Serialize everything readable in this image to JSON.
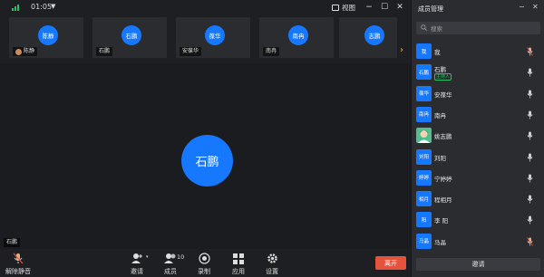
{
  "top_bar": {
    "time": "01:05",
    "view_label": "视图"
  },
  "thumbnails": [
    {
      "avatar": "陈静",
      "name": "陈静"
    },
    {
      "avatar": "石鹏",
      "name": "石鹏"
    },
    {
      "avatar": "葆华",
      "name": "安葆华"
    },
    {
      "avatar": "南冉",
      "name": "南冉"
    },
    {
      "avatar": "志鹏",
      "name": ""
    }
  ],
  "stage": {
    "avatar_text": "石鹏",
    "name_tag": "石鹏"
  },
  "toolbar": {
    "unmute_label": "解除静音",
    "invite_label": "邀请",
    "members_label": "成员",
    "members_count": "10",
    "record_label": "录制",
    "apps_label": "应用",
    "settings_label": "设置",
    "leave_label": "离开"
  },
  "panel": {
    "title": "成员管理",
    "search_placeholder": "搜索",
    "invite_label": "邀请",
    "members": [
      {
        "avatar": "我",
        "name": "我",
        "role": "",
        "avatar_type": "blue",
        "mic": "user"
      },
      {
        "avatar": "石鹏",
        "name": "石鹏",
        "role": "主持人",
        "avatar_type": "blue",
        "mic": "normal"
      },
      {
        "avatar": "葆华",
        "name": "安葆华",
        "role": "",
        "avatar_type": "blue",
        "mic": "normal"
      },
      {
        "avatar": "南冉",
        "name": "南冉",
        "role": "",
        "avatar_type": "blue",
        "mic": "normal"
      },
      {
        "avatar": "",
        "name": "姚志鹏",
        "role": "",
        "avatar_type": "photo",
        "mic": "normal"
      },
      {
        "avatar": "刘阳",
        "name": "刘阳",
        "role": "",
        "avatar_type": "blue",
        "mic": "normal"
      },
      {
        "avatar": "婷婷",
        "name": "宁婷婷",
        "role": "",
        "avatar_type": "blue",
        "mic": "normal"
      },
      {
        "avatar": "相月",
        "name": "程相月",
        "role": "",
        "avatar_type": "blue",
        "mic": "normal"
      },
      {
        "avatar": "阳",
        "name": "李 阳",
        "role": "",
        "avatar_type": "blue",
        "mic": "normal"
      },
      {
        "avatar": "马晶",
        "name": "马晶",
        "role": "",
        "avatar_type": "blue",
        "mic": "user"
      }
    ]
  },
  "colors": {
    "accent_blue": "#1677ff",
    "leave_red": "#e5533d",
    "signal_green": "#22c55e"
  }
}
